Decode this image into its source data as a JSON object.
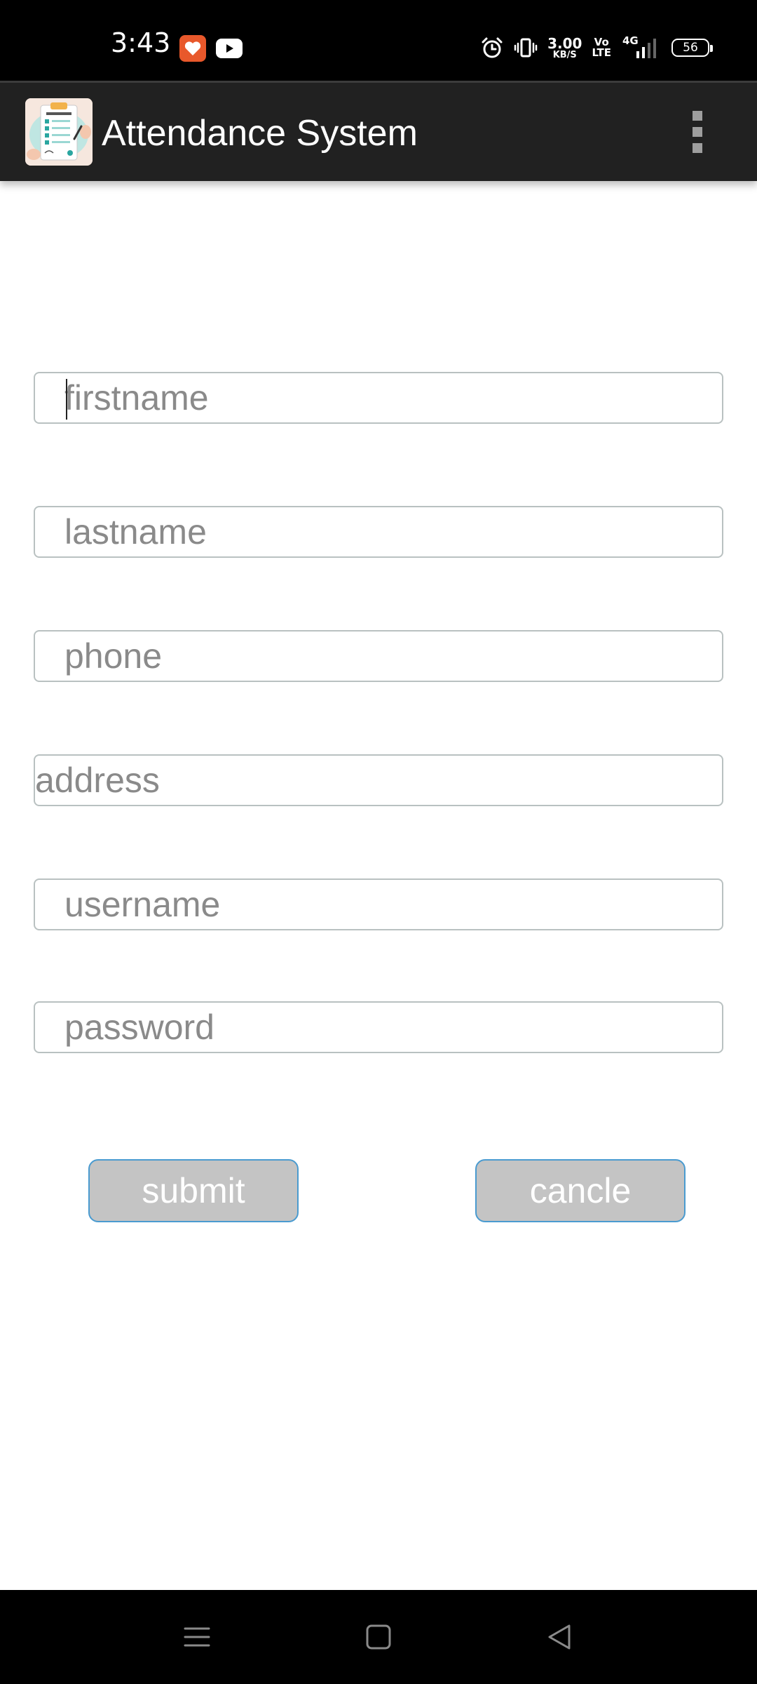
{
  "status_bar": {
    "time": "3:43",
    "net_speed_value": "3.00",
    "net_speed_unit": "KB/S",
    "volte_top": "Vo",
    "volte_bottom": "LTE",
    "network_type": "4G",
    "battery": "56",
    "notification_icons": [
      "heart-app-icon",
      "youtube-icon"
    ],
    "system_icons": [
      "alarm-icon",
      "vibrate-icon",
      "signal-icon"
    ]
  },
  "app_bar": {
    "title": "Attendance System",
    "icon": "attendance-clipboard-icon",
    "menu_icon": "more-vertical-icon"
  },
  "form": {
    "fields": [
      {
        "name": "firstname",
        "placeholder": "firstname",
        "value": ""
      },
      {
        "name": "lastname",
        "placeholder": "lastname",
        "value": ""
      },
      {
        "name": "phone",
        "placeholder": "phone",
        "value": ""
      },
      {
        "name": "address",
        "placeholder": "address",
        "value": ""
      },
      {
        "name": "username",
        "placeholder": "username",
        "value": ""
      },
      {
        "name": "password",
        "placeholder": "password",
        "value": ""
      }
    ],
    "submit_label": "submit",
    "cancel_label": "cancle"
  },
  "nav_bar": {
    "icons": [
      "menu-icon",
      "home-icon",
      "back-icon"
    ]
  },
  "colors": {
    "status_bar_bg": "#000000",
    "app_bar_bg": "#212121",
    "field_border": "#b9c1c1",
    "placeholder_text": "#8a8a8a",
    "button_bg": "#c4c4c4",
    "button_border": "#4a9bd0",
    "heart_app": "#e8582b"
  }
}
